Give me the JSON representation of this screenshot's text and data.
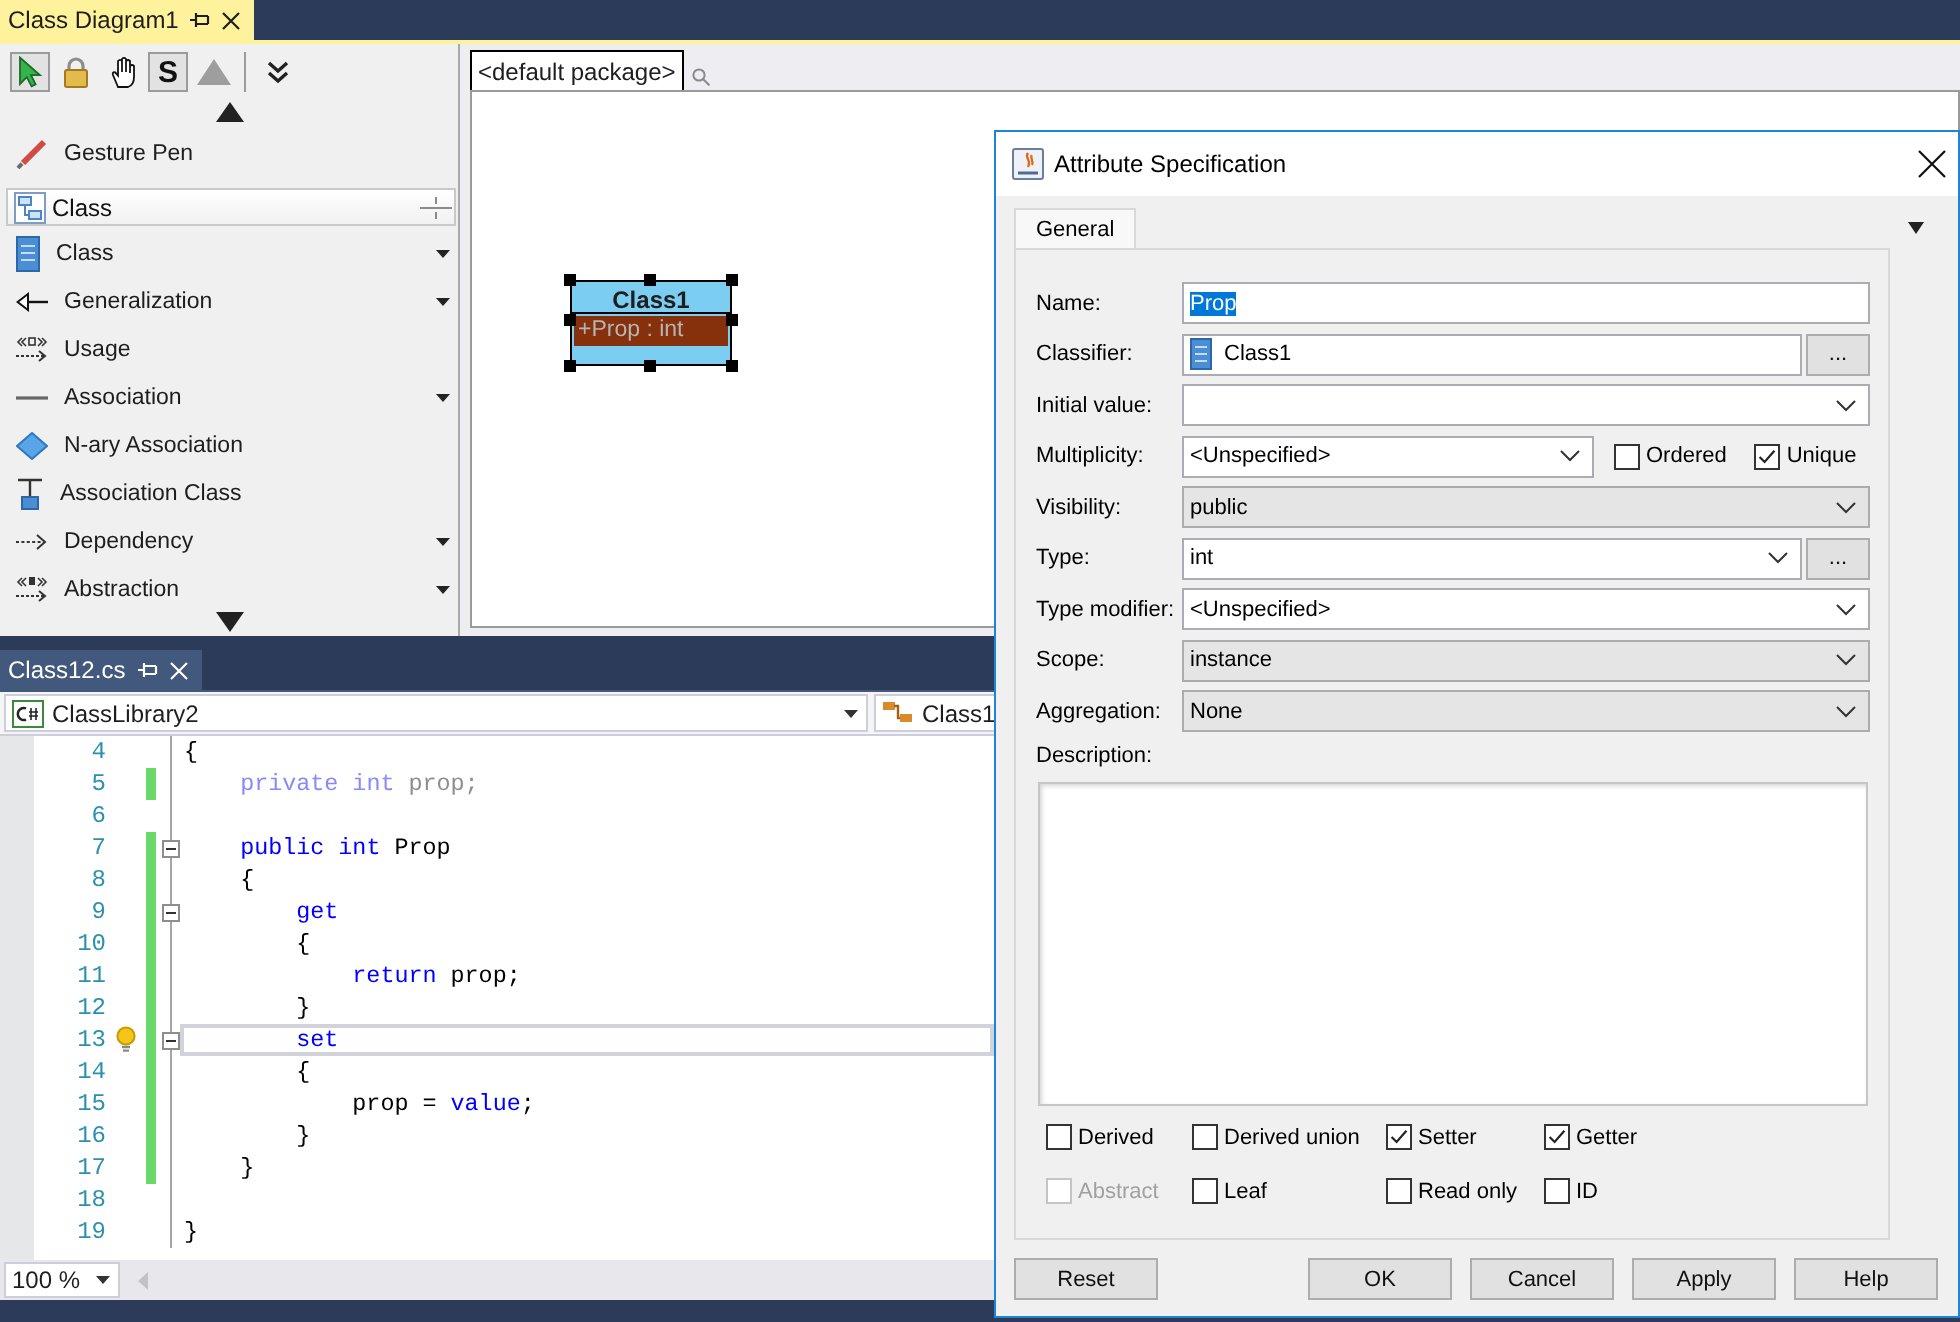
{
  "diagram_window": {
    "tab": {
      "title": "Class Diagram1",
      "focused": true
    },
    "palette": {
      "tools": [
        {
          "kind": "pointer",
          "selected": true
        },
        {
          "kind": "lock",
          "selected": false
        },
        {
          "kind": "hand",
          "selected": false
        },
        {
          "kind": "letter",
          "label": "S",
          "selected": true
        },
        {
          "kind": "triangle",
          "selected": false
        }
      ],
      "items": [
        {
          "kind": "pen",
          "label": "Gesture Pen",
          "has_menu": false
        }
      ],
      "group": {
        "title": "Class",
        "items": [
          {
            "kind": "class",
            "label": "Class",
            "has_menu": true
          },
          {
            "kind": "generalization",
            "label": "Generalization",
            "has_menu": true
          },
          {
            "kind": "usage",
            "label": "Usage",
            "has_menu": false
          },
          {
            "kind": "association",
            "label": "Association",
            "has_menu": true
          },
          {
            "kind": "nary",
            "label": "N-ary Association",
            "has_menu": false
          },
          {
            "kind": "associationclass",
            "label": "Association Class",
            "has_menu": false
          },
          {
            "kind": "dependency",
            "label": "Dependency",
            "has_menu": true
          },
          {
            "kind": "abstraction",
            "label": "Abstraction",
            "has_menu": true
          }
        ]
      }
    },
    "package_tab": "<default package>",
    "classes": [
      {
        "name": "Class1",
        "selected": true,
        "attributes": [
          {
            "text": "+Prop : int",
            "selected": true
          }
        ]
      }
    ]
  },
  "code_window": {
    "tab": {
      "title": "Class12.cs",
      "focused": false
    },
    "project": "ClassLibrary2",
    "type": "Class1",
    "lines": [
      {
        "number": "4",
        "changed": false,
        "foldable": false,
        "current": false,
        "lightbulb": false,
        "tokens": [
          {
            "text": "{",
            "kind": "plain"
          }
        ]
      },
      {
        "number": "5",
        "changed": true,
        "foldable": false,
        "current": false,
        "lightbulb": false,
        "tokens": [
          {
            "text": "    private",
            "kind": "faded-keyword"
          },
          {
            "text": " int",
            "kind": "faded-keyword"
          },
          {
            "text": " prop;",
            "kind": "faded"
          }
        ]
      },
      {
        "number": "6",
        "changed": false,
        "foldable": false,
        "current": false,
        "lightbulb": false
      },
      {
        "number": "7",
        "changed": true,
        "foldable": true,
        "current": false,
        "lightbulb": false,
        "tokens": [
          {
            "text": "    public",
            "kind": "keyword"
          },
          {
            "text": " int",
            "kind": "keyword"
          },
          {
            "text": " Prop",
            "kind": "plain"
          }
        ]
      },
      {
        "number": "8",
        "changed": true,
        "foldable": false,
        "current": false,
        "lightbulb": false,
        "tokens": [
          {
            "text": "    {",
            "kind": "plain"
          }
        ]
      },
      {
        "number": "9",
        "changed": true,
        "foldable": true,
        "current": false,
        "lightbulb": false,
        "tokens": [
          {
            "text": "        get",
            "kind": "keyword"
          }
        ]
      },
      {
        "number": "10",
        "changed": true,
        "foldable": false,
        "current": false,
        "lightbulb": false,
        "tokens": [
          {
            "text": "        {",
            "kind": "plain"
          }
        ]
      },
      {
        "number": "11",
        "changed": true,
        "foldable": false,
        "current": false,
        "lightbulb": false,
        "tokens": [
          {
            "text": "            return",
            "kind": "keyword"
          },
          {
            "text": " prop;",
            "kind": "plain"
          }
        ]
      },
      {
        "number": "12",
        "changed": true,
        "foldable": false,
        "current": false,
        "lightbulb": false,
        "tokens": [
          {
            "text": "        }",
            "kind": "plain"
          }
        ]
      },
      {
        "number": "13",
        "changed": true,
        "foldable": true,
        "current": true,
        "lightbulb": true,
        "tokens": [
          {
            "text": "        set",
            "kind": "keyword"
          }
        ]
      },
      {
        "number": "14",
        "changed": true,
        "foldable": false,
        "current": false,
        "lightbulb": false,
        "tokens": [
          {
            "text": "        {",
            "kind": "plain"
          }
        ]
      },
      {
        "number": "15",
        "changed": true,
        "foldable": false,
        "current": false,
        "lightbulb": false,
        "tokens": [
          {
            "text": "            prop = ",
            "kind": "plain"
          },
          {
            "text": "value",
            "kind": "keyword"
          },
          {
            "text": ";",
            "kind": "plain"
          }
        ]
      },
      {
        "number": "16",
        "changed": true,
        "foldable": false,
        "current": false,
        "lightbulb": false,
        "tokens": [
          {
            "text": "        }",
            "kind": "plain"
          }
        ]
      },
      {
        "number": "17",
        "changed": true,
        "foldable": false,
        "current": false,
        "lightbulb": false,
        "tokens": [
          {
            "text": "    }",
            "kind": "plain"
          }
        ]
      },
      {
        "number": "18",
        "changed": false,
        "foldable": false,
        "current": false,
        "lightbulb": false
      },
      {
        "number": "19",
        "changed": false,
        "foldable": false,
        "current": false,
        "lightbulb": false,
        "tokens": [
          {
            "text": "}",
            "kind": "plain"
          }
        ]
      }
    ],
    "zoom": "100 %"
  },
  "dialog": {
    "title": "Attribute Specification",
    "tabs": [
      {
        "label": "General",
        "selected": true
      }
    ],
    "fields": [
      {
        "label": "Name:",
        "kind": "text",
        "value": "Prop",
        "highlighted": true
      },
      {
        "label": "Classifier:",
        "kind": "reference",
        "value": "Class1",
        "button": "..."
      },
      {
        "label": "Initial value:",
        "kind": "combo"
      },
      {
        "label": "Multiplicity:",
        "kind": "combo",
        "value": "<Unspecified>",
        "checks": [
          {
            "label": "Ordered",
            "checked": false
          },
          {
            "label": "Unique",
            "checked": true
          }
        ]
      },
      {
        "label": "Visibility:",
        "kind": "choice",
        "value": "public"
      },
      {
        "label": "Type:",
        "kind": "combo",
        "value": "int",
        "button": "..."
      },
      {
        "label": "Type modifier:",
        "kind": "combo",
        "value": "<Unspecified>"
      },
      {
        "label": "Scope:",
        "kind": "choice",
        "value": "instance"
      },
      {
        "label": "Aggregation:",
        "kind": "choice",
        "value": "None"
      }
    ],
    "description": {
      "label": "Description:"
    },
    "options": [
      {
        "label": "Derived",
        "checked": false,
        "disabled": false
      },
      {
        "label": "Derived union",
        "checked": false,
        "disabled": false
      },
      {
        "label": "Setter",
        "checked": true,
        "disabled": false
      },
      {
        "label": "Getter",
        "checked": true,
        "disabled": false
      },
      {
        "label": "Abstract",
        "checked": false,
        "disabled": true
      },
      {
        "label": "Leaf",
        "checked": false,
        "disabled": false
      },
      {
        "label": "Read only",
        "checked": false,
        "disabled": false
      },
      {
        "label": "ID",
        "checked": false,
        "disabled": false
      }
    ],
    "buttons": [
      "Reset",
      "OK",
      "Cancel",
      "Apply",
      "Help"
    ]
  }
}
